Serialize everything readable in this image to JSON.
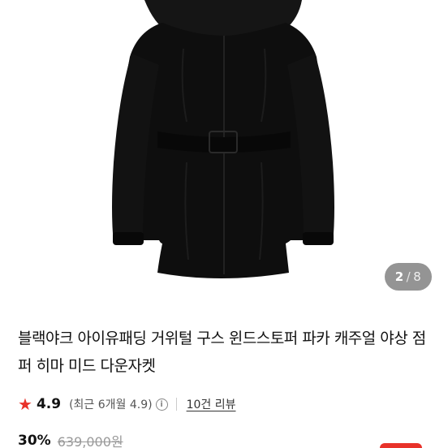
{
  "product": {
    "image_page": {
      "current": "2",
      "separator": "/",
      "total": "8"
    },
    "title": "블랙야크 아이유패딩 거위털 구스 윈드스토퍼 파카 캐주얼 야상 점퍼 히마 미드 다운자켓",
    "rating": {
      "score": "4.9",
      "recent": "(최근 6개월 4.9)",
      "info_icon": "i",
      "reviews": "10건 리뷰"
    },
    "price": {
      "discount": "30%",
      "original": "639,000원"
    }
  },
  "icons": {
    "star": "star-icon",
    "info": "info-icon"
  },
  "colors": {
    "accent": "#e8322a",
    "jacket": "#0d0d0d",
    "indicator_bg": "rgba(0,0,0,0.42)"
  }
}
